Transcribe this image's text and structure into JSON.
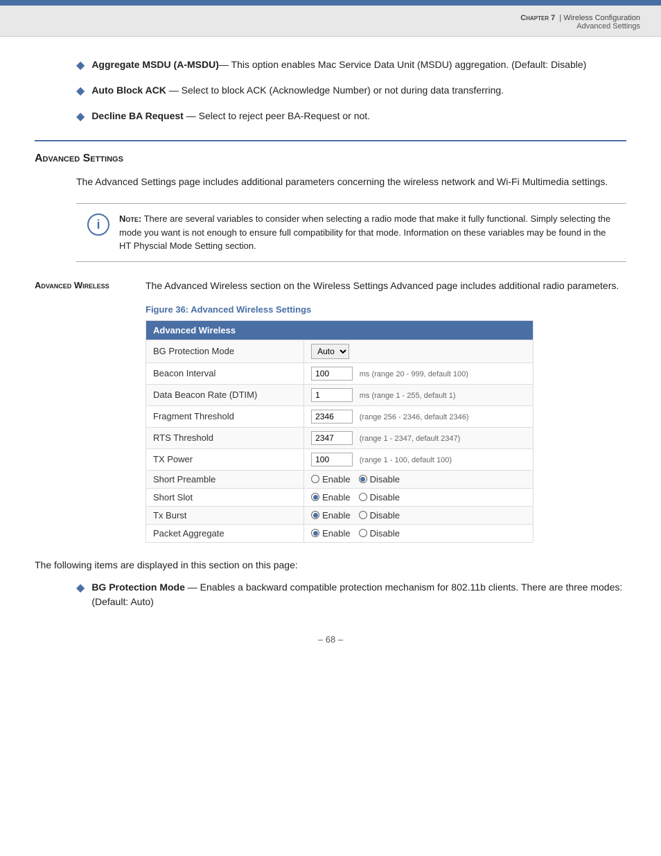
{
  "header": {
    "bar_color": "#4a6fa5",
    "chapter_label": "Chapter",
    "chapter_number": "7",
    "chapter_separator": "|",
    "chapter_title": "Wireless Configuration",
    "sub_title": "Advanced Settings"
  },
  "bullets": [
    {
      "title": "Aggregate MSDU (A-MSDU)",
      "dash": "—",
      "text": " This option enables Mac Service Data Unit (MSDU) aggregation. (Default: Disable)"
    },
    {
      "title": "Auto Block ACK",
      "dash": "—",
      "text": " Select to block ACK (Acknowledge Number) or not during data transferring."
    },
    {
      "title": "Decline BA Request",
      "dash": "—",
      "text": " Select to reject peer BA-Request or not."
    }
  ],
  "advanced_settings": {
    "heading": "Advanced Settings",
    "description": "The Advanced Settings page includes additional parameters concerning the wireless network and Wi-Fi Multimedia settings.",
    "note": {
      "label": "Note:",
      "text": " There are several variables to consider when selecting a radio mode that make it fully functional. Simply selecting the mode you want is not enough to ensure full compatibility for that mode. Information on these variables may be found in the HT Physcial Mode Setting section."
    }
  },
  "advanced_wireless": {
    "label": "Advanced Wireless",
    "description": "The Advanced Wireless section on the Wireless Settings Advanced page includes additional radio parameters.",
    "figure_label": "Figure 36:  Advanced Wireless Settings",
    "table": {
      "header": "Advanced Wireless",
      "rows": [
        {
          "field": "BG Protection Mode",
          "control_type": "select",
          "value": "Auto"
        },
        {
          "field": "Beacon Interval",
          "control_type": "input",
          "value": "100",
          "hint": "ms (range 20 - 999, default 100)"
        },
        {
          "field": "Data Beacon Rate (DTIM)",
          "control_type": "input",
          "value": "1",
          "hint": "ms (range 1 - 255, default 1)"
        },
        {
          "field": "Fragment Threshold",
          "control_type": "input",
          "value": "2346",
          "hint": "(range 256 - 2346, default 2346)"
        },
        {
          "field": "RTS Threshold",
          "control_type": "input",
          "value": "2347",
          "hint": "(range 1 - 2347, default 2347)"
        },
        {
          "field": "TX Power",
          "control_type": "input",
          "value": "100",
          "hint": "(range 1 - 100, default 100)"
        },
        {
          "field": "Short Preamble",
          "control_type": "radio",
          "options": [
            "Enable",
            "Disable"
          ],
          "selected": "Disable"
        },
        {
          "field": "Short Slot",
          "control_type": "radio",
          "options": [
            "Enable",
            "Disable"
          ],
          "selected": "Enable"
        },
        {
          "field": "Tx Burst",
          "control_type": "radio",
          "options": [
            "Enable",
            "Disable"
          ],
          "selected": "Enable"
        },
        {
          "field": "Packet Aggregate",
          "control_type": "radio",
          "options": [
            "Enable",
            "Disable"
          ],
          "selected": "Enable"
        }
      ]
    }
  },
  "following_text": "The following items are displayed in this section on this page:",
  "following_bullets": [
    {
      "title": "BG Protection Mode",
      "dash": "—",
      "text": " Enables a backward compatible protection mechanism for 802.11b clients. There are three modes: (Default: Auto)"
    }
  ],
  "page_number": "– 68 –"
}
